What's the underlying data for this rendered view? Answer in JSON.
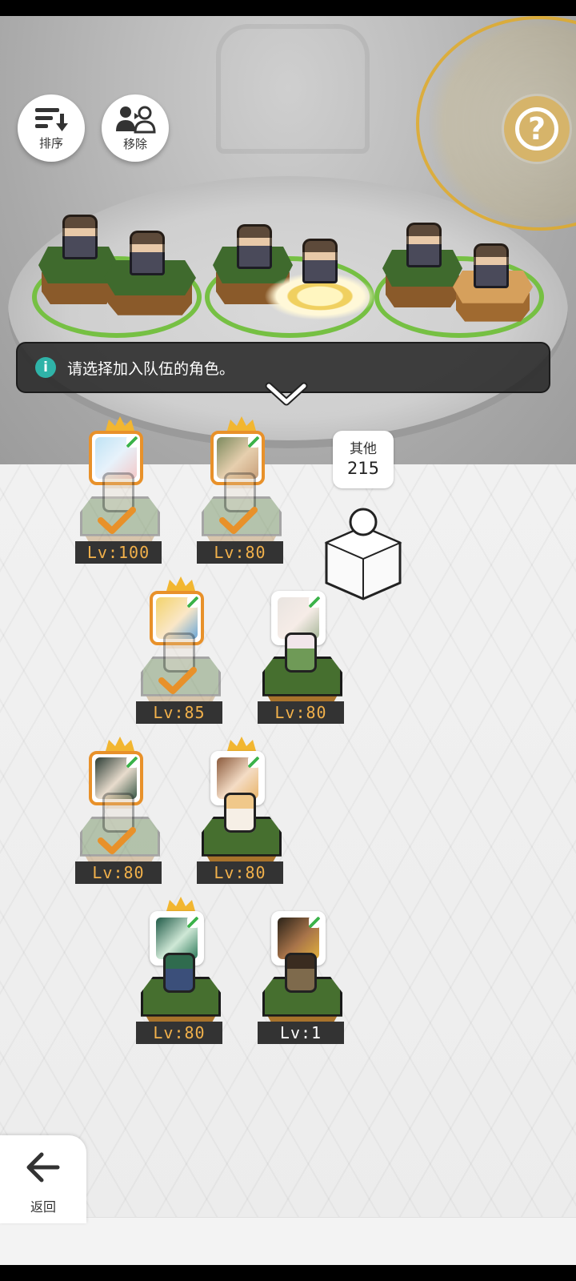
{
  "toolbar": {
    "sort_label": "排序",
    "remove_label": "移除",
    "help_glyph": "?"
  },
  "banner": {
    "message": "请选择加入队伍的角色。",
    "info_glyph": "i"
  },
  "other": {
    "label": "其他",
    "count": "215"
  },
  "roster": [
    {
      "level": "Lv:100",
      "selected": true,
      "leader": true
    },
    {
      "level": "Lv:80",
      "selected": true,
      "leader": true
    },
    {
      "level": "Lv:85",
      "selected": true,
      "leader": true
    },
    {
      "level": "Lv:80",
      "selected": false,
      "leader": false
    },
    {
      "level": "Lv:80",
      "selected": true,
      "leader": true
    },
    {
      "level": "Lv:80",
      "selected": false,
      "leader": true
    },
    {
      "level": "Lv:80",
      "selected": false,
      "leader": true
    },
    {
      "level": "Lv:1",
      "selected": false,
      "leader": false
    }
  ],
  "footer": {
    "back_label": "返回"
  },
  "colors": {
    "accent_orange": "#e8912a",
    "info_teal": "#2fb3a8",
    "help_gold": "#d6b46a",
    "level_text": "#f2b14b"
  },
  "icons": [
    "sort-icon",
    "remove-member-icon",
    "help-icon",
    "info-icon",
    "chevron-down-icon",
    "check-icon",
    "crown-icon",
    "back-arrow-icon"
  ]
}
